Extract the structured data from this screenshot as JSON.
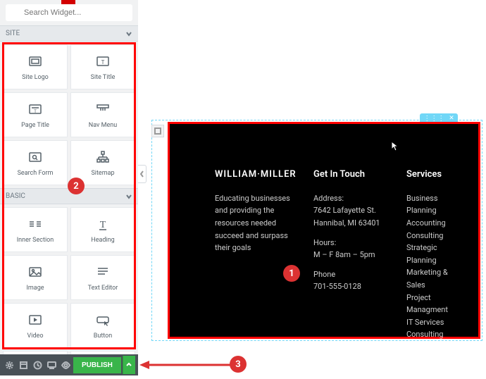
{
  "search": {
    "placeholder": "Search Widget..."
  },
  "categories": {
    "site": "SITE",
    "basic": "BASIC"
  },
  "widgets": {
    "site": [
      {
        "name": "site-logo",
        "label": "Site Logo"
      },
      {
        "name": "site-title",
        "label": "Site Title"
      },
      {
        "name": "page-title",
        "label": "Page Title"
      },
      {
        "name": "nav-menu",
        "label": "Nav Menu"
      },
      {
        "name": "search-form",
        "label": "Search Form"
      },
      {
        "name": "sitemap",
        "label": "Sitemap"
      }
    ],
    "basic": [
      {
        "name": "inner-section",
        "label": "Inner Section"
      },
      {
        "name": "heading",
        "label": "Heading"
      },
      {
        "name": "image",
        "label": "Image"
      },
      {
        "name": "text-editor",
        "label": "Text Editor"
      },
      {
        "name": "video",
        "label": "Video"
      },
      {
        "name": "button",
        "label": "Button"
      }
    ]
  },
  "publish": "PUBLISH",
  "badges": {
    "one": "1",
    "two": "2",
    "three": "3"
  },
  "section_tag": {
    "close": "✕"
  },
  "footer": {
    "brand": "WILLIAM·MILLER",
    "about": "Educating businesses and providing the resources needed succeed and surpass their goals",
    "touch": {
      "title": "Get In Touch",
      "address_label": "Address:",
      "address1": "7642 Lafayette St.",
      "address2": "Hannibal, MI 63401",
      "hours_label": "Hours:",
      "hours": "M – F 8am – 5pm",
      "phone_label": "Phone",
      "phone": "701-555-0128"
    },
    "services": {
      "title": "Services",
      "items": [
        "Business Planning",
        "Accounting",
        "Consulting",
        "Strategic Planning",
        "Marketing & Sales",
        "Project Managment",
        "IT Services",
        "Consulting"
      ]
    }
  }
}
